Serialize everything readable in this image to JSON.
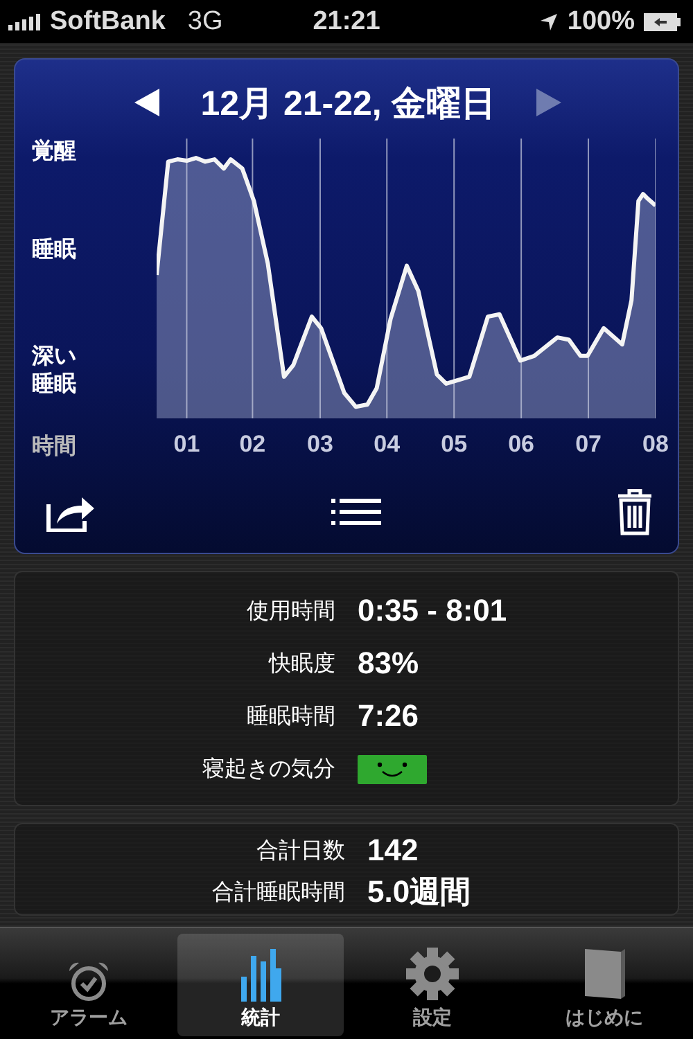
{
  "status_bar": {
    "carrier": "SoftBank",
    "network": "3G",
    "time": "21:21",
    "battery": "100%"
  },
  "chart_card": {
    "title": "12月 21-22, 金曜日",
    "prev_enabled": true,
    "next_enabled": false,
    "y_labels": [
      "覚醒",
      "睡眠",
      "深い睡眠"
    ],
    "x_axis_label": "時間",
    "x_labels": [
      "01",
      "02",
      "03",
      "04",
      "05",
      "06",
      "07",
      "08"
    ]
  },
  "summary": [
    {
      "label": "使用時間",
      "kind": "text",
      "value": "0:35 - 8:01"
    },
    {
      "label": "快眠度",
      "kind": "text",
      "value": "83%"
    },
    {
      "label": "睡眠時間",
      "kind": "text",
      "value": "7:26"
    },
    {
      "label": "寝起きの気分",
      "kind": "mood"
    }
  ],
  "totals": [
    {
      "label": "合計日数",
      "value": "142"
    },
    {
      "label": "合計睡眠時間",
      "value": "5.0週間"
    }
  ],
  "tabs": [
    {
      "label": "アラーム",
      "selected": false
    },
    {
      "label": "統計",
      "selected": true
    },
    {
      "label": "設定",
      "selected": false
    },
    {
      "label": "はじめに",
      "selected": false
    }
  ]
}
